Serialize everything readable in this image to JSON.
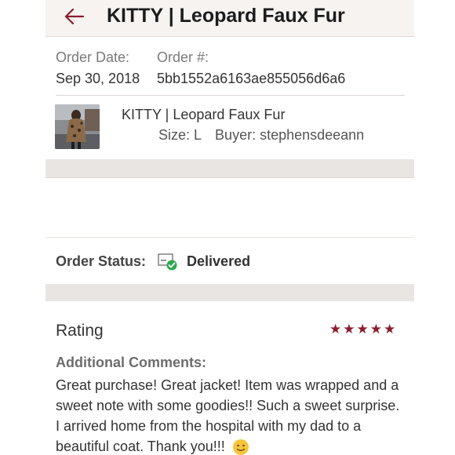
{
  "header": {
    "title": "KITTY | Leopard Faux Fur",
    "back_icon": "back-arrow-icon",
    "accent_color": "#8a1d2e"
  },
  "order": {
    "date_label": "Order Date:",
    "date_value": "Sep 30, 2018",
    "number_label": "Order #:",
    "number_value": "5bb1552a6163ae855056d6a6"
  },
  "item": {
    "title": "KITTY | Leopard Faux Fur",
    "size": "Size: L",
    "buyer": "Buyer: stephensdeeann"
  },
  "status": {
    "label": "Order Status:",
    "icon": "delivered-box-icon",
    "value": "Delivered"
  },
  "rating": {
    "label": "Rating",
    "stars": 5,
    "comments_label": "Additional Comments:",
    "comments": "Great purchase! Great jacket! Item was wrapped and a sweet note with some goodies!! Such a sweet surprise. I arrived home from the hospital with my dad to a beautiful coat. Thank you!!!",
    "emoji": "smiley-emoji-icon"
  }
}
